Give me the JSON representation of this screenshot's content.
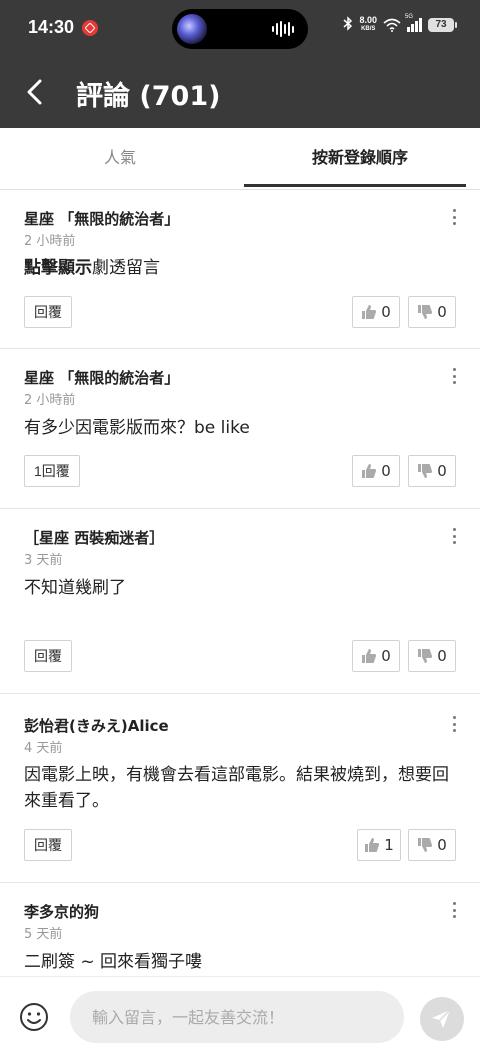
{
  "status_bar": {
    "time": "14:30",
    "network_speed": "8.00",
    "network_speed_unit": "KB/S",
    "signal_type": "5G",
    "battery": "73"
  },
  "header": {
    "title": "評論 (701)"
  },
  "tabs": [
    {
      "label": "人氣",
      "active": false
    },
    {
      "label": "按新登錄順序",
      "active": true
    }
  ],
  "comments": [
    {
      "author": "星座 「無限的統治者」",
      "time": "2 小時前",
      "text_bold": "點擊顯示",
      "text": "劇透留言",
      "reply_label": "回覆",
      "likes": "0",
      "dislikes": "0"
    },
    {
      "author": "星座 「無限的統治者」",
      "time": "2 小時前",
      "text": "有多少因電影版而來？be like",
      "reply_label": "1回覆",
      "likes": "0",
      "dislikes": "0"
    },
    {
      "author": "［星座 西裝痴迷者］",
      "time": "3 天前",
      "text": "不知道幾刷了",
      "reply_label": "回覆",
      "likes": "0",
      "dislikes": "0"
    },
    {
      "author": "彭怡君(きみえ)Alice",
      "time": "4 天前",
      "text": "因電影上映，有機會去看這部電影。結果被燒到，想要回來重看了。",
      "reply_label": "回覆",
      "likes": "1",
      "dislikes": "0"
    },
    {
      "author": "李多京的狗",
      "time": "5 天前",
      "text": "二刷簽 ~ 回來看獨子嘍"
    }
  ],
  "input": {
    "placeholder": "輸入留言，一起友善交流！"
  },
  "colors": {
    "header_bg": "#3a3a3a",
    "notification_badge": "#e53935"
  },
  "icons": {
    "back": "chevron-left-icon",
    "more": "more-vertical-icon",
    "like": "thumbs-up-icon",
    "dislike": "thumbs-down-icon",
    "emoji": "smiley-icon",
    "send": "send-icon"
  }
}
